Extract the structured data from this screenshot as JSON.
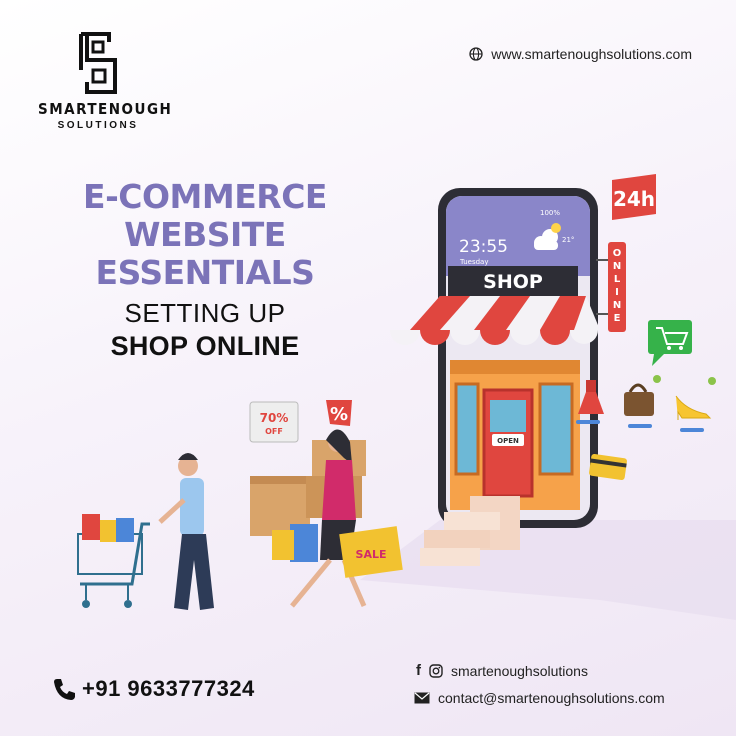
{
  "brand": {
    "name": "SMARTENOUGH",
    "subtitle": "SOLUTIONS"
  },
  "website": "www.smartenoughsolutions.com",
  "headline": {
    "line1": "E-COMMERCE",
    "line2": "WEBSITE",
    "line3": "ESSENTIALS",
    "sub1": "SETTING UP",
    "sub2": "SHOP ONLINE"
  },
  "illustration": {
    "time": "23:55",
    "day": "Tuesday",
    "battery": "100%",
    "temperature": "21°",
    "shop_sign": "SHOP",
    "door_sign": "OPEN",
    "badge_24h": "24h",
    "online_sign": "ONLINE",
    "discount_tag": "70%",
    "discount_off": "OFF",
    "percent_tag": "%",
    "sale_bag": "SALE"
  },
  "contact": {
    "phone": "+91 9633777324",
    "social": "smartenoughsolutions",
    "email": "contact@smartenoughsolutions.com"
  },
  "colors": {
    "headline": "#7b73b8",
    "awning_red": "#e0463f",
    "phone_screen": "#8a86c9",
    "shop_wall": "#f6a24a"
  }
}
